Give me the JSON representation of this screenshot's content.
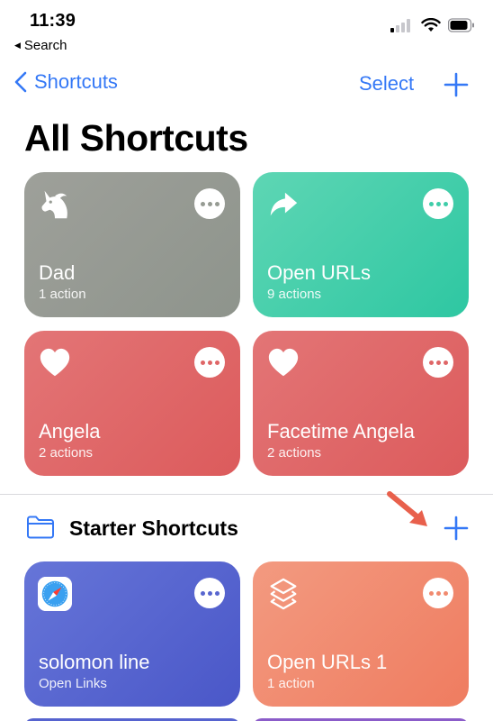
{
  "status_bar": {
    "time": "11:39",
    "back_app": "Search"
  },
  "nav": {
    "back_label": "Shortcuts",
    "select_label": "Select"
  },
  "page_title": "All Shortcuts",
  "shortcuts": [
    {
      "name": "Dad",
      "subtitle": "1 action",
      "icon": "unicorn-icon",
      "color": "#969b93"
    },
    {
      "name": "Open URLs",
      "subtitle": "9 actions",
      "icon": "share-arrow-icon",
      "color": "#3fcda9"
    },
    {
      "name": "Angela",
      "subtitle": "2 actions",
      "icon": "heart-icon",
      "color": "#df6667"
    },
    {
      "name": "Facetime Angela",
      "subtitle": "2 actions",
      "icon": "heart-icon",
      "color": "#df6667"
    }
  ],
  "section": {
    "title": "Starter Shortcuts"
  },
  "starter_shortcuts": [
    {
      "name": "solomon line",
      "subtitle": "Open Links",
      "icon": "safari-icon",
      "color": "#5866cf"
    },
    {
      "name": "Open URLs 1",
      "subtitle": "1 action",
      "icon": "shortcuts-layers-icon",
      "color": "#f18a6f"
    }
  ],
  "colors": {
    "accent": "#3478f6",
    "annotation_arrow": "#e8604c"
  }
}
